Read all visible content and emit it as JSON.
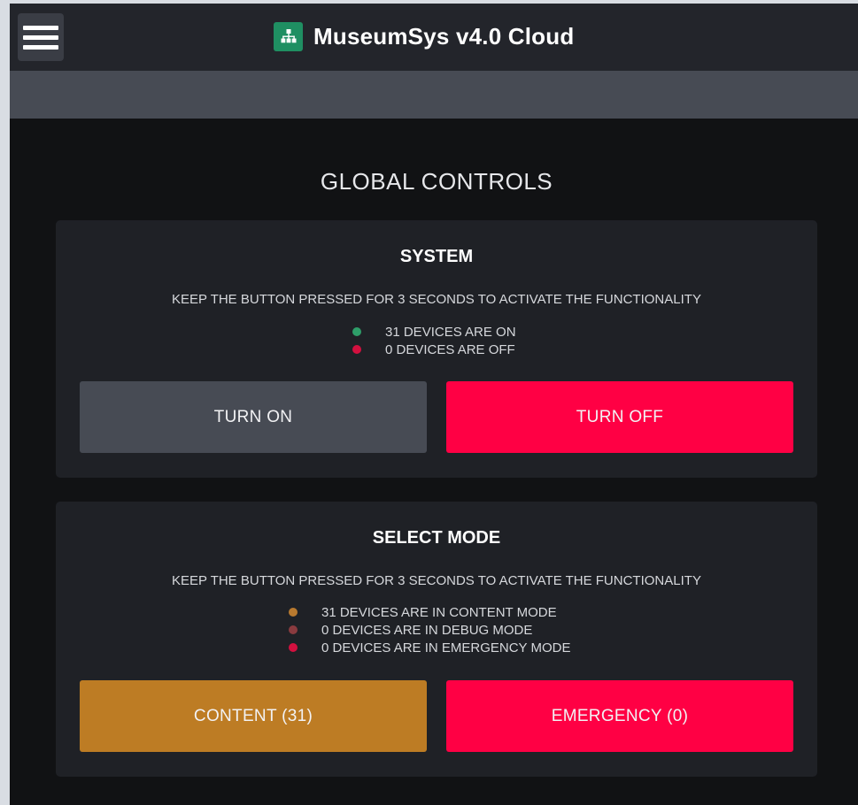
{
  "header": {
    "title": "MuseumSys v4.0 Cloud",
    "menu_icon": "hamburger-menu-icon",
    "brand_icon": "network-tree-icon",
    "brand_color": "#1f8f62"
  },
  "page": {
    "title": "GLOBAL CONTROLS"
  },
  "system": {
    "title": "SYSTEM",
    "instruction": "KEEP THE BUTTON PRESSED FOR 3 SECONDS TO ACTIVATE THE FUNCTIONALITY",
    "status": [
      {
        "text": "31 DEVICES ARE ON",
        "color": "#2e9e69"
      },
      {
        "text": "0 DEVICES ARE OFF",
        "color": "#d3103f"
      }
    ],
    "buttons": {
      "turn_on": {
        "label": "TURN ON",
        "color": "#474b54"
      },
      "turn_off": {
        "label": "TURN OFF",
        "color": "#ff0044"
      }
    }
  },
  "mode": {
    "title": "SELECT MODE",
    "instruction": "KEEP THE BUTTON PRESSED FOR 3 SECONDS TO ACTIVATE THE FUNCTIONALITY",
    "status": [
      {
        "text": "31 DEVICES ARE IN CONTENT MODE",
        "color": "#b97a2f"
      },
      {
        "text": "0 DEVICES ARE IN DEBUG MODE",
        "color": "#8a3b3f"
      },
      {
        "text": "0 DEVICES ARE IN EMERGENCY MODE",
        "color": "#d3103f"
      }
    ],
    "buttons": {
      "content": {
        "label": "CONTENT (31)",
        "color": "#bd7c24"
      },
      "emergency": {
        "label": "EMERGENCY (0)",
        "color": "#ff0044"
      }
    }
  }
}
